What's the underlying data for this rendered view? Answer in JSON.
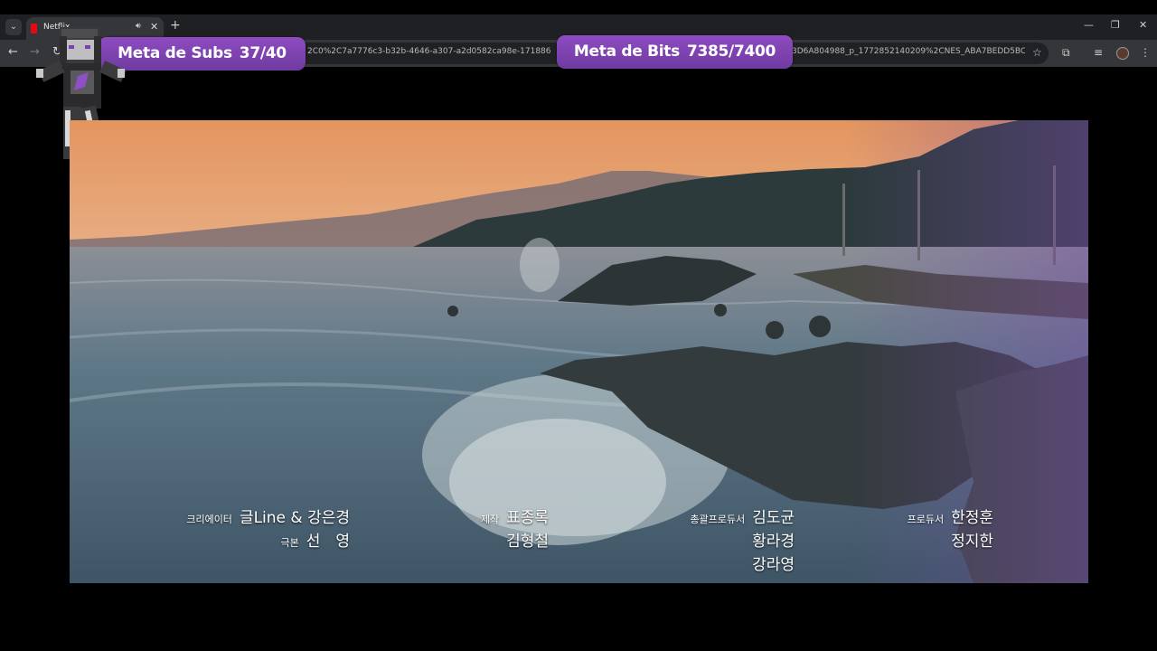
{
  "browser": {
    "tab": {
      "title": "Netflix"
    },
    "url": {
      "segment_1": "2C0%2C7a7776c3-b32b-4646-a307-a2d0582ca98e-17188610%2C",
      "segment_2": "3D6A804988_p_1772852140209%2CNES_ABA7BEDD5BCC18..."
    },
    "icons": {
      "tab_list": "chevron-down-icon",
      "audio": "speaker-icon",
      "close": "close-icon",
      "new_tab": "plus-icon",
      "back": "arrow-left-icon",
      "forward": "arrow-right-icon",
      "reload": "reload-icon",
      "bookmark": "star-icon",
      "extensions": "puzzle-icon",
      "media": "media-control-icon",
      "menu": "kebab-menu-icon"
    }
  },
  "overlays": {
    "subs_goal": {
      "label": "Meta de Subs",
      "value": "37/40"
    },
    "bits_goal": {
      "label": "Meta de Bits",
      "value": "7385/7400"
    },
    "badge_color": "#7f44b0"
  },
  "credits": {
    "creator": {
      "role": "크리에이터",
      "name": "글Line & 강은경"
    },
    "screenplay": {
      "role": "극본",
      "name": "선　영"
    },
    "production": {
      "role": "제작",
      "names": [
        "표종록",
        "김형철"
      ]
    },
    "chief_producer": {
      "role": "총괄프로듀서",
      "names": [
        "김도균",
        "황라경",
        "강라영"
      ]
    },
    "producer": {
      "role": "프로듀서",
      "names": [
        "한정훈",
        "정지한"
      ]
    }
  }
}
